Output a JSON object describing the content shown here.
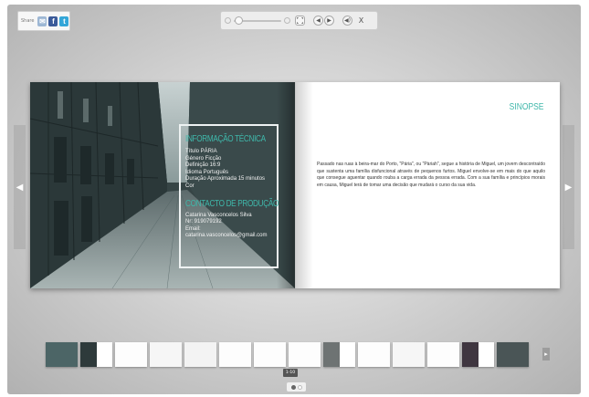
{
  "share": {
    "label": "Share",
    "icons": [
      "mail-icon",
      "facebook-icon",
      "twitter-icon"
    ]
  },
  "toolbar": {
    "zoom_level": 0.05,
    "fullscreen_icon": "fullscreen-icon",
    "prev_icon": "◀",
    "next_icon": "▶",
    "sound_icon": "◀)",
    "close_label": "X"
  },
  "navigation": {
    "prev_arrow": "◀",
    "next_arrow": "▶",
    "thumb_next": "▸"
  },
  "left_page": {
    "tech_title": "INFORMAÇÃO TÉCNICA",
    "tech_lines": [
      "Título PÁRIA",
      "Género Ficção",
      "Definição 16:9",
      "Idioma Português",
      "Duração Aproximada 15  minutos",
      "Cor"
    ],
    "contact_title": "CONTACTO DE PRODUÇÃO",
    "contact_lines": [
      "Catarina Vasconcelos Silva",
      "Nr: 919079192",
      "Email:",
      "catarina.vasconcelos@gmail.com"
    ]
  },
  "right_page": {
    "title": "SINOPSE",
    "synopsis": "Passado nas ruas à beira-mar do Porto, \"Pária\", ou \"Pàriah\", segue a história de Miguel, um jovem descontraído que sustenta uma família disfuncional através de pequenos furtos. Miguel envolve-se em mais do que aquilo que consegue aguentar quando rouba a carga errada da pessoa errada. Com a sua família e princípios morais em causa, Miguel terá de tomar uma decisão que mudará o curso da sua vida."
  },
  "colors": {
    "accent": "#3fb7aa",
    "page_bg": "#ffffff",
    "frame": "#d6d6d6"
  },
  "page_tooltip": "1-10",
  "pager": {
    "pages": 2,
    "current": 1
  }
}
